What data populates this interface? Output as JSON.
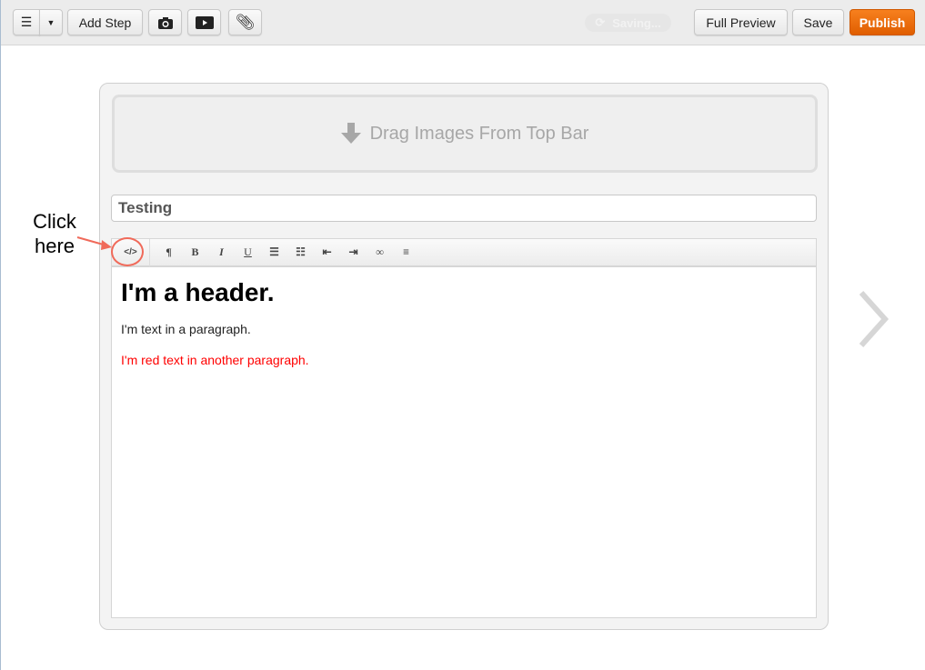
{
  "topbar": {
    "add_step": "Add Step",
    "saving": "Saving...",
    "full_preview": "Full Preview",
    "save": "Save",
    "publish": "Publish",
    "publish_color": "#f07010"
  },
  "card": {
    "drop_text": "Drag Images From Top Bar",
    "title_value": "Testing"
  },
  "editor": {
    "toolbar": [
      "html-source",
      "paragraph",
      "bold",
      "italic",
      "underline",
      "bullet-list",
      "numbered-list",
      "outdent",
      "indent",
      "link",
      "align"
    ],
    "bold_label": "B",
    "italic_label": "I",
    "underline_label": "U",
    "html_label": "</>",
    "para_label": "¶",
    "header": "I'm a header.",
    "paragraph": "I'm text in a paragraph.",
    "red_paragraph": "I'm red text in another paragraph.",
    "red_color": "#ff0000"
  },
  "annotation": {
    "text": "Click here"
  }
}
